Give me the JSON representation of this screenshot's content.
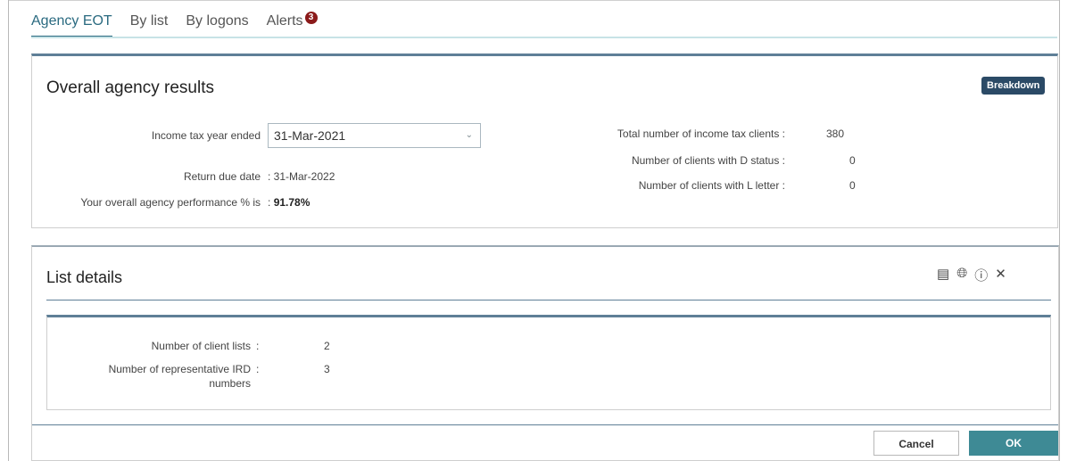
{
  "tabs": [
    {
      "label": "Agency EOT",
      "active": true
    },
    {
      "label": "By list",
      "active": false
    },
    {
      "label": "By logons",
      "active": false
    },
    {
      "label": "Alerts",
      "active": false,
      "badge": "3"
    }
  ],
  "overall": {
    "title": "Overall agency results",
    "breakdown_label": "Breakdown",
    "income_tax_year_label": "Income tax year ended",
    "income_tax_year_value": "31-Mar-2021",
    "return_due_label": "Return due date",
    "return_due_value": ": 31-Mar-2022",
    "performance_label": "Your overall agency performance % is",
    "performance_sep": ":",
    "performance_value": "91.78%",
    "stats": [
      {
        "label": "Total number of income tax clients  :",
        "value": "380"
      },
      {
        "label": "Number of clients with D status  :",
        "value": "0"
      },
      {
        "label": "Number of clients with L letter  :",
        "value": "0"
      }
    ]
  },
  "list_details": {
    "title": "List details",
    "icons": [
      "list-icon",
      "globe-icon",
      "help-icon",
      "close-icon"
    ],
    "rows": [
      {
        "label": "Number of client lists",
        "sep": ":",
        "value": "2"
      },
      {
        "label_line1": "Number of representative IRD",
        "label_line2": "numbers",
        "sep": ":",
        "value": "3"
      }
    ],
    "cancel_label": "Cancel",
    "ok_label": "OK"
  },
  "colors": {
    "accent": "#2a6a80",
    "badge": "#8b1a1a",
    "breakdown": "#2b4a66",
    "ok": "#3e8a95"
  }
}
